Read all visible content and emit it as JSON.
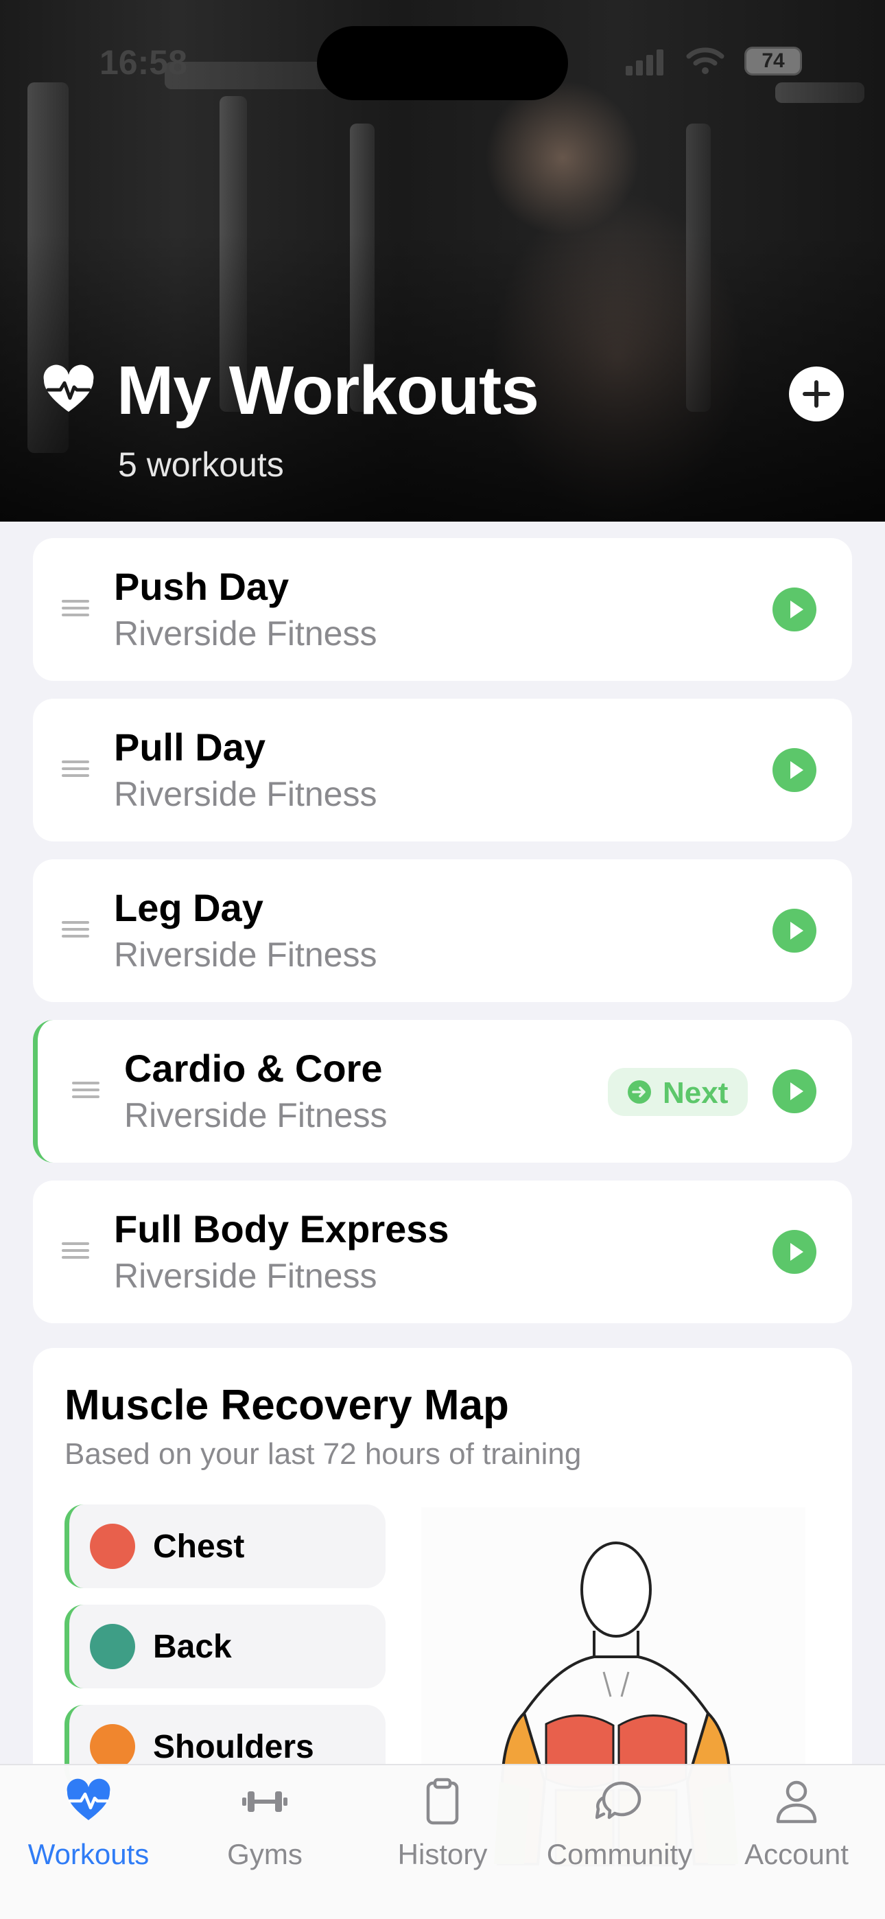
{
  "status_bar": {
    "time": "16:58",
    "battery": "74"
  },
  "header": {
    "title": "My Workouts",
    "subtitle": "5 workouts"
  },
  "workouts": [
    {
      "name": "Push Day",
      "gym": "Riverside Fitness"
    },
    {
      "name": "Pull Day",
      "gym": "Riverside Fitness"
    },
    {
      "name": "Leg Day",
      "gym": "Riverside Fitness"
    },
    {
      "name": "Cardio & Core",
      "gym": "Riverside Fitness",
      "badge": "Next"
    },
    {
      "name": "Full Body Express",
      "gym": "Riverside Fitness"
    }
  ],
  "recovery": {
    "title": "Muscle Recovery Map",
    "subtitle": "Based on your last 72 hours of training",
    "muscles": [
      {
        "label": "Chest",
        "color": "#E8604C"
      },
      {
        "label": "Back",
        "color": "#3E9E86"
      },
      {
        "label": "Shoulders",
        "color": "#F0862E"
      }
    ]
  },
  "tabs": [
    {
      "label": "Workouts",
      "icon": "heart-pulse-icon",
      "active": true
    },
    {
      "label": "Gyms",
      "icon": "dumbbell-icon"
    },
    {
      "label": "History",
      "icon": "clipboard-icon"
    },
    {
      "label": "Community",
      "icon": "chat-bubbles-icon"
    },
    {
      "label": "Account",
      "icon": "person-icon"
    }
  ],
  "colors": {
    "accent_green": "#5CC76A",
    "tab_active": "#2F7CF6",
    "background": "#F2F2F7"
  }
}
